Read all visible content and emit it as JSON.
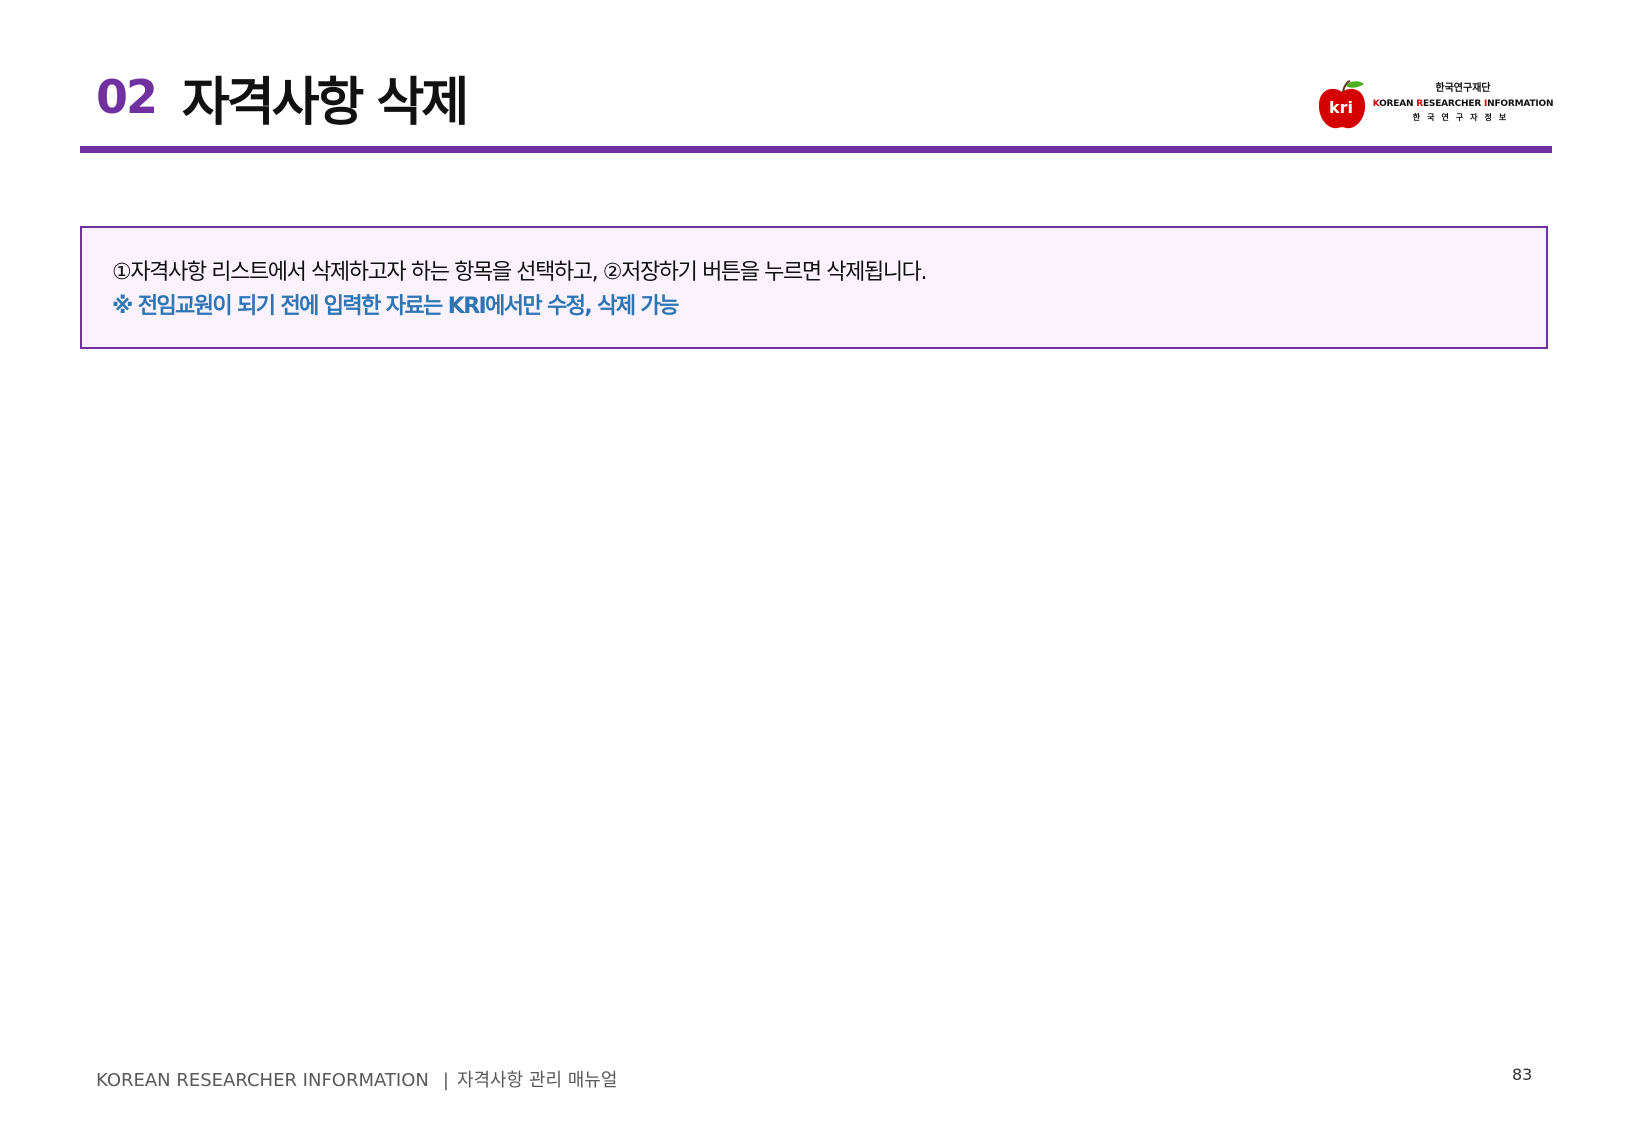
{
  "header": {
    "section_number": "02",
    "title": "자격사항 삭제"
  },
  "logo": {
    "org": "한국연구재단",
    "name_k": "K",
    "name_orean": "OREAN ",
    "name_r": "R",
    "name_esearcher": "ESEARCHER ",
    "name_i": "I",
    "name_nformation": "NFORMATION",
    "sub": "한국연구자정보",
    "badge": "kri",
    "colors": {
      "apple": "#d40000",
      "leaf": "#4caf1f",
      "text_accent": "#d40000"
    }
  },
  "notice": {
    "line1": "①자격사항 리스트에서 삭제하고자 하는 항목을 선택하고, ②저장하기 버튼을 누르면 삭제됩니다.",
    "line2": "※ 전임교원이 되기 전에 입력한 자료는 KRI에서만 수정, 삭제 가능"
  },
  "footer": {
    "left": "KOREAN RESEARCHER INFORMATION",
    "separator": "|",
    "manual": "자격사항 관리 매뉴얼",
    "page_number": "83"
  },
  "colors": {
    "accent": "#7030a0",
    "notice_bg": "#faf3fe",
    "notice_highlight": "#2e75b6"
  }
}
